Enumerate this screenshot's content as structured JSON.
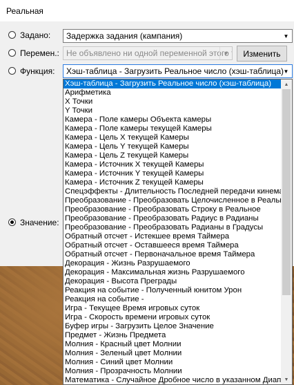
{
  "window": {
    "title": "Реальная"
  },
  "rows": {
    "preset": {
      "label": "Задано:",
      "value": "Задержка задания (кампания)"
    },
    "variable": {
      "label": "Перемен.:",
      "value": "Не объявлено ни одной переменной этого ти",
      "button": "Изменить"
    },
    "function": {
      "label": "Функция:",
      "value": "Хэш-таблица - Загрузить Реальное число (хэш-таблица)"
    },
    "value": {
      "label": "Значение:"
    }
  },
  "selected_radio": "value",
  "dropdown_items": [
    "Хэш-таблица - Загрузить Реальное число (хэш-таблица)",
    "Арифметика",
    "X Точки",
    "Y Точки",
    "Камера - Поле камеры Объекта камеры",
    "Камера - Поле камеры текущей Камеры",
    "Камера - Цель X текущей Камеры",
    "Камера - Цель Y текущей Камеры",
    "Камера - Цель Z текущей Камеры",
    "Камера - Источник X текущей Камеры",
    "Камера - Источник Y текущей Камеры",
    "Камера - Источник Z текущей Камеры",
    "Спецэффекты - Длительность Последней передачи кинемато",
    "Преобразование - Преобразовать Целочисленное в Реальное",
    "Преобразование - Преобразовать Строку в Реальное",
    "Преобразование - Преобразовать Радиус в Радианы",
    "Преобразование - Преобразовать Радианы в Градусы",
    "Обратный отсчет - Истекшее время Таймера",
    "Обратный отсчет - Оставшееся время Таймера",
    "Обратный отсчет - Первоначальное время Таймера",
    "Декорация - Жизнь Разрушаемого",
    "Декорация - Максимальная жизнь Разрушаемого",
    "Декорация - Высота Преграды",
    "Реакция на событие - Полученный юнитом Урон",
    "Реакция на событие -",
    "Игра - Текущее Время игровых суток",
    "Игра - Скорость времени игровых суток",
    "Буфер игры - Загрузить Целое Значение",
    "Предмет - Жизнь Предмета",
    "Молния - Красный цвет Молнии",
    "Молния - Зеленый цвет Молнии",
    "Молния - Синий цвет Молнии",
    "Молния - Прозрачность Молнии",
    "Математика - Случайное Дробное число в указанном Диапаз"
  ],
  "dropdown_selected_index": 0,
  "icons": {
    "combo_arrow": "chevron-down-icon",
    "scroll_up": "scroll-up-arrow-icon",
    "scroll_down": "scroll-down-arrow-icon"
  }
}
